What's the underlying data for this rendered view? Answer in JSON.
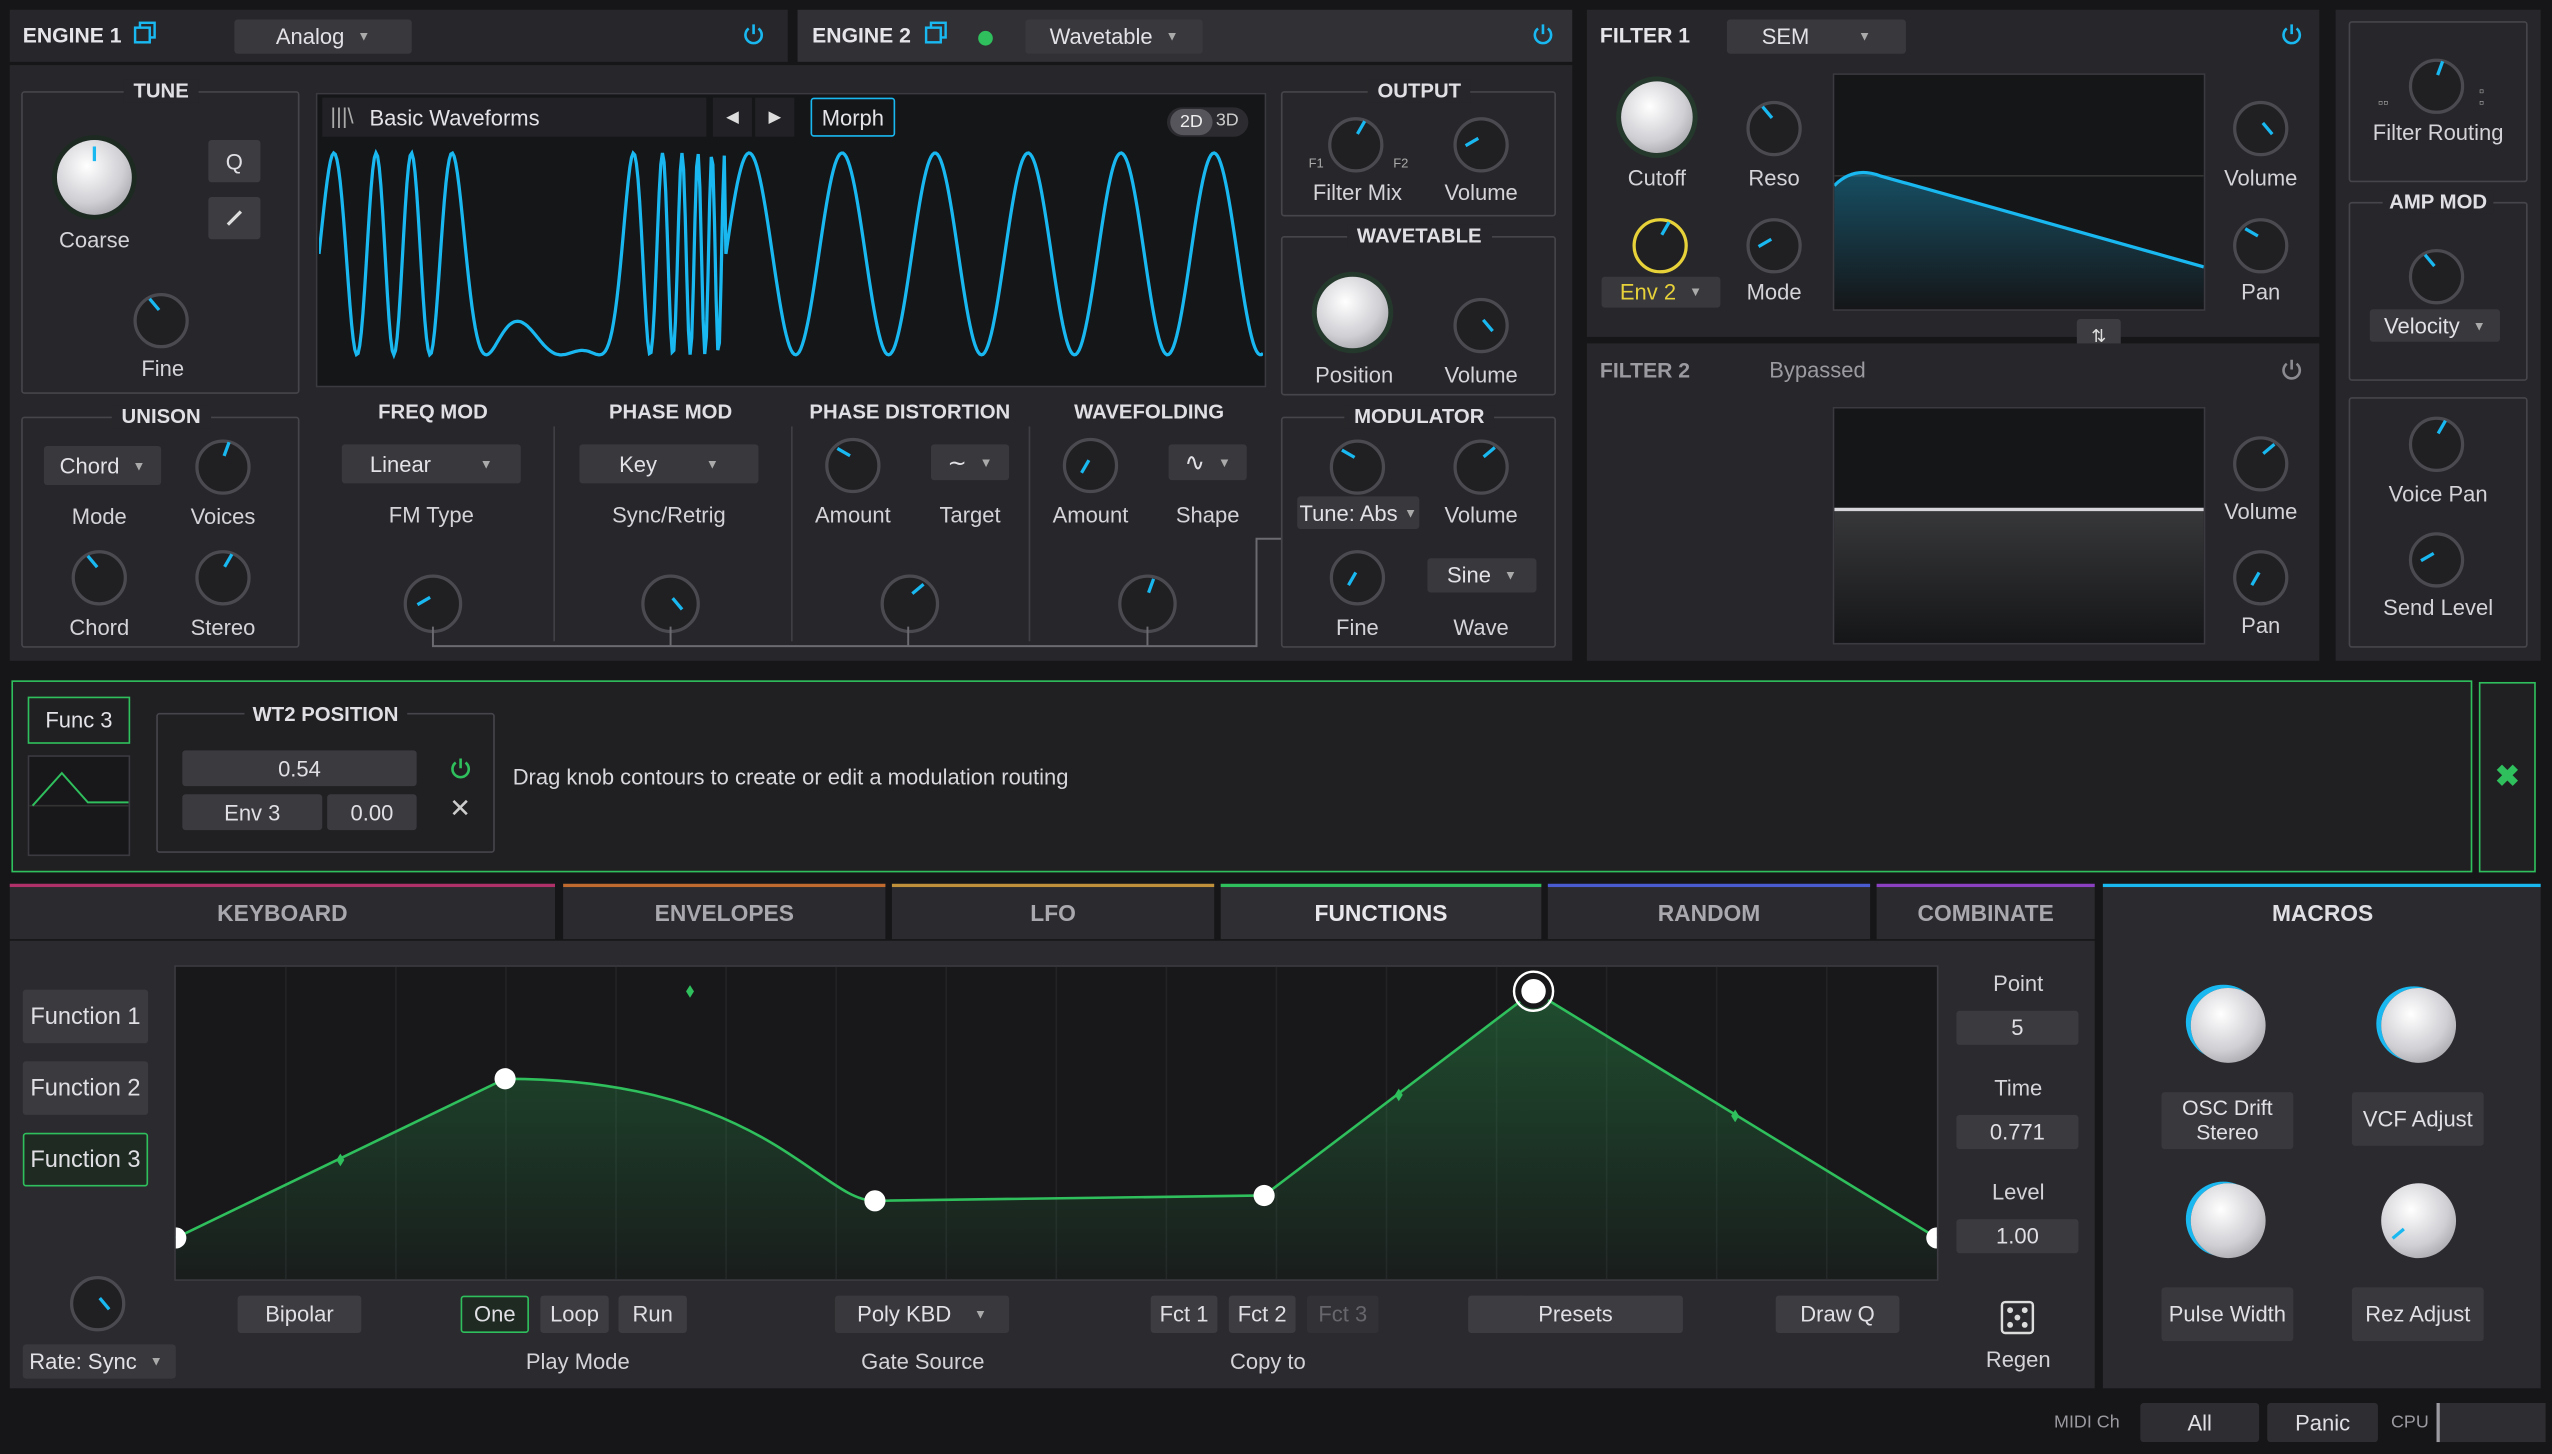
{
  "engine1": {
    "title": "ENGINE 1",
    "type": "Analog"
  },
  "engine2": {
    "title": "ENGINE 2",
    "type": "Wavetable"
  },
  "tune": {
    "header": "TUNE",
    "coarse": "Coarse",
    "fine": "Fine",
    "q_label": "Q"
  },
  "wavetable_display": {
    "name": "Basic Waveforms",
    "morph": "Morph",
    "mode_2d": "2D",
    "mode_3d": "3D"
  },
  "output": {
    "header": "OUTPUT",
    "filter_mix": "Filter Mix",
    "f1": "F1",
    "f2": "F2",
    "volume": "Volume"
  },
  "wavetable": {
    "header": "WAVETABLE",
    "position": "Position",
    "volume": "Volume"
  },
  "modulator": {
    "header": "MODULATOR",
    "tune_mode": "Tune: Abs",
    "volume": "Volume",
    "fine": "Fine",
    "wave_value": "Sine",
    "wave": "Wave"
  },
  "unison": {
    "header": "UNISON",
    "mode_value": "Chord",
    "mode": "Mode",
    "voices": "Voices",
    "chord": "Chord",
    "stereo": "Stereo"
  },
  "freq_mod": {
    "header": "FREQ MOD",
    "value": "Linear",
    "label": "FM Type"
  },
  "phase_mod": {
    "header": "PHASE MOD",
    "value": "Key",
    "label": "Sync/Retrig"
  },
  "phase_distortion": {
    "header": "PHASE DISTORTION",
    "amount": "Amount",
    "target": "Target"
  },
  "wavefolding": {
    "header": "WAVEFOLDING",
    "amount": "Amount",
    "shape": "Shape"
  },
  "filter1": {
    "title": "FILTER 1",
    "type": "SEM",
    "cutoff": "Cutoff",
    "reso": "Reso",
    "env_value": "Env 2",
    "mode": "Mode",
    "volume": "Volume",
    "pan": "Pan"
  },
  "filter2": {
    "title": "FILTER 2",
    "status": "Bypassed",
    "volume": "Volume",
    "pan": "Pan"
  },
  "right_col": {
    "filter_routing": "Filter Routing",
    "amp_mod": "AMP MOD",
    "velocity": "Velocity",
    "voice_pan": "Voice Pan",
    "send_level": "Send Level"
  },
  "mod_strip": {
    "source": "Func 3",
    "target_header": "WT2 POSITION",
    "value": "0.54",
    "mod_source": "Env 3",
    "mod_amount": "0.00",
    "hint": "Drag knob contours to create or edit a modulation routing"
  },
  "tabs": [
    "KEYBOARD",
    "ENVELOPES",
    "LFO",
    "FUNCTIONS",
    "RANDOM",
    "COMBINATE"
  ],
  "functions": {
    "items": [
      "Function 1",
      "Function 2",
      "Function 3"
    ],
    "rate": "Rate: Sync",
    "bipolar": "Bipolar",
    "play_modes": [
      "One",
      "Loop",
      "Run"
    ],
    "play_mode": "Play Mode",
    "gate_value": "Poly KBD",
    "gate_source": "Gate Source",
    "copy": [
      "Fct 1",
      "Fct 2",
      "Fct 3"
    ],
    "copy_to": "Copy to",
    "presets": "Presets",
    "draw": "Draw Q",
    "regen": "Regen",
    "point_label": "Point",
    "point": "5",
    "time_label": "Time",
    "time": "0.771",
    "level_label": "Level",
    "level": "1.00"
  },
  "function_curve": {
    "points": [
      {
        "time": 0.0,
        "level": 0.07
      },
      {
        "time": 0.187,
        "level": 0.67
      },
      {
        "time": 0.397,
        "level": 0.21
      },
      {
        "time": 0.618,
        "level": 0.23
      },
      {
        "time": 0.771,
        "level": 1.0
      },
      {
        "time": 1.0,
        "level": 0.07
      }
    ]
  },
  "macros": {
    "header": "MACROS",
    "items": [
      "OSC Drift Stereo",
      "VCF Adjust",
      "Pulse Width",
      "Rez Adjust"
    ]
  },
  "footer": {
    "midi_ch": "MIDI Ch",
    "all": "All",
    "panic": "Panic",
    "cpu": "CPU"
  },
  "colors": {
    "accent_blue": "#19b8f0",
    "accent_green": "#2fbf5c",
    "env_yellow": "#e8d23a"
  }
}
